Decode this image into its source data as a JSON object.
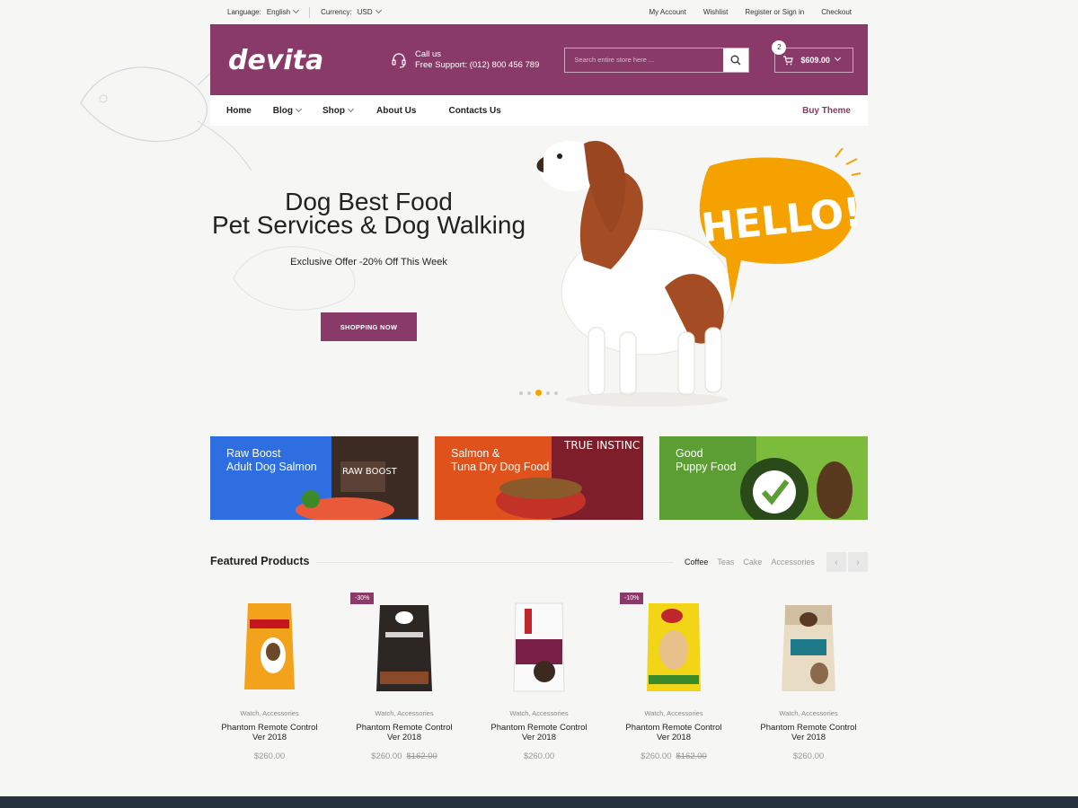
{
  "topbar": {
    "language_label": "Language:",
    "language_value": "English",
    "currency_label": "Currency:",
    "currency_value": "USD",
    "links": [
      "My Account",
      "Wishlist",
      "Register or Sign in",
      "Checkout"
    ]
  },
  "header": {
    "logo_text": "devita",
    "support_line1": "Call us",
    "support_line2": "Free Support: (012) 800 456 789",
    "search_placeholder": "Search entire store here ...",
    "cart_count": "2",
    "cart_total": "$609.00"
  },
  "nav": {
    "items": [
      "Home",
      "Blog",
      "Shop",
      "About Us",
      "Contacts Us"
    ],
    "buy_theme": "Buy Theme"
  },
  "hero": {
    "title_line1": "Dog Best Food",
    "title_line2": "Pet Services & Dog Walking",
    "offer": "Exclusive Offer -20% Off This Week",
    "button": "SHOPPING NOW",
    "bubble_text": "HELLO!"
  },
  "banners": [
    {
      "line1": "Raw Boost",
      "line2": "Adult Dog Salmon",
      "color": "#2f6ee0"
    },
    {
      "line1": "Salmon &",
      "line2": "Tuna Dry Dog Food",
      "color": "#e0521c"
    },
    {
      "line1": "Good",
      "line2": "Puppy Food",
      "color": "#5c9e33"
    }
  ],
  "featured": {
    "title": "Featured Products",
    "tabs": [
      "Coffee",
      "Teas",
      "Cake",
      "Accessories"
    ],
    "products": [
      {
        "cats": "Watch, Accessories",
        "name1": "Phantom Remote Control",
        "name2": "Ver 2018",
        "price": "$260.00",
        "old": "",
        "sale": ""
      },
      {
        "cats": "Watch, Accessories",
        "name1": "Phantom Remote Control",
        "name2": "Ver 2018",
        "price": "$260.00",
        "old": "$162.00",
        "sale": "-30%"
      },
      {
        "cats": "Watch, Accessories",
        "name1": "Phantom Remote Control",
        "name2": "Ver 2018",
        "price": "$260.00",
        "old": "",
        "sale": ""
      },
      {
        "cats": "Watch, Accessories",
        "name1": "Phantom Remote Control",
        "name2": "Ver 2018",
        "price": "$260.00",
        "old": "$162.00",
        "sale": "-10%"
      },
      {
        "cats": "Watch, Accessories",
        "name1": "Phantom Remote Control",
        "name2": "Ver 2018",
        "price": "$260.00",
        "old": "",
        "sale": ""
      }
    ]
  },
  "colors": {
    "brand": "#8a3a68",
    "accent": "#f0a400",
    "footer": "#26323d"
  }
}
